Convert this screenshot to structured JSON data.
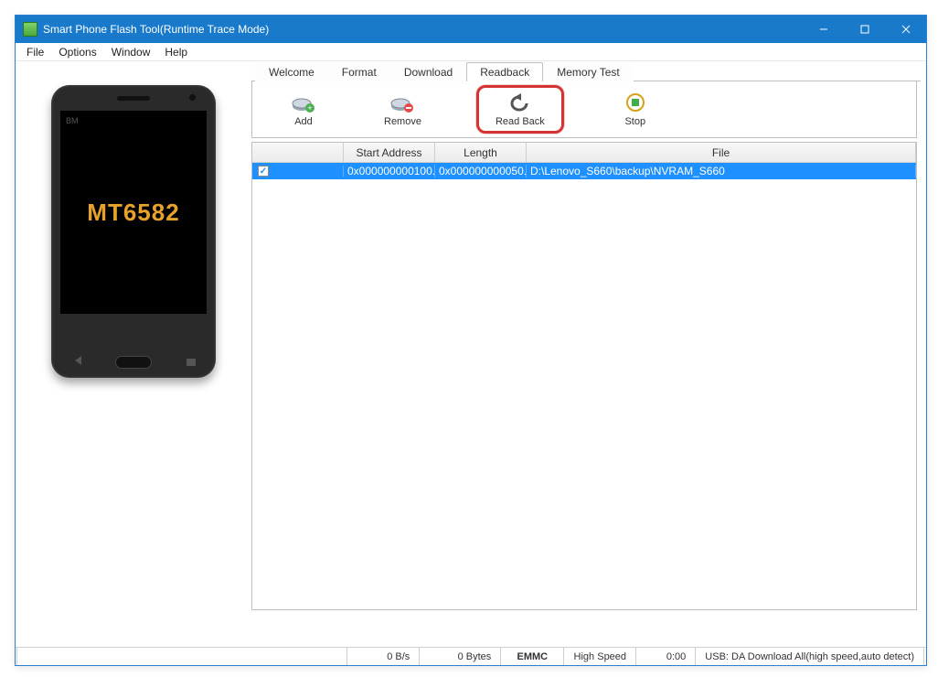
{
  "window": {
    "title": "Smart Phone Flash Tool(Runtime Trace Mode)"
  },
  "menu": {
    "file": "File",
    "options": "Options",
    "window": "Window",
    "help": "Help"
  },
  "phone": {
    "brand": "BM",
    "chip": "MT6582"
  },
  "tabs": {
    "welcome": "Welcome",
    "format": "Format",
    "download": "Download",
    "readback": "Readback",
    "memtest": "Memory Test"
  },
  "toolbar": {
    "add": "Add",
    "remove": "Remove",
    "readback": "Read Back",
    "stop": "Stop"
  },
  "table": {
    "headers": {
      "addr": "Start Address",
      "len": "Length",
      "file": "File"
    },
    "rows": [
      {
        "checked": true,
        "addr": "0x000000000100...",
        "len": "0x000000000050...",
        "file": "D:\\Lenovo_S660\\backup\\NVRAM_S660"
      }
    ]
  },
  "status": {
    "rate": "0 B/s",
    "bytes": "0 Bytes",
    "storage": "EMMC",
    "speed": "High Speed",
    "time": "0:00",
    "usb": "USB: DA Download All(high speed,auto detect)"
  }
}
